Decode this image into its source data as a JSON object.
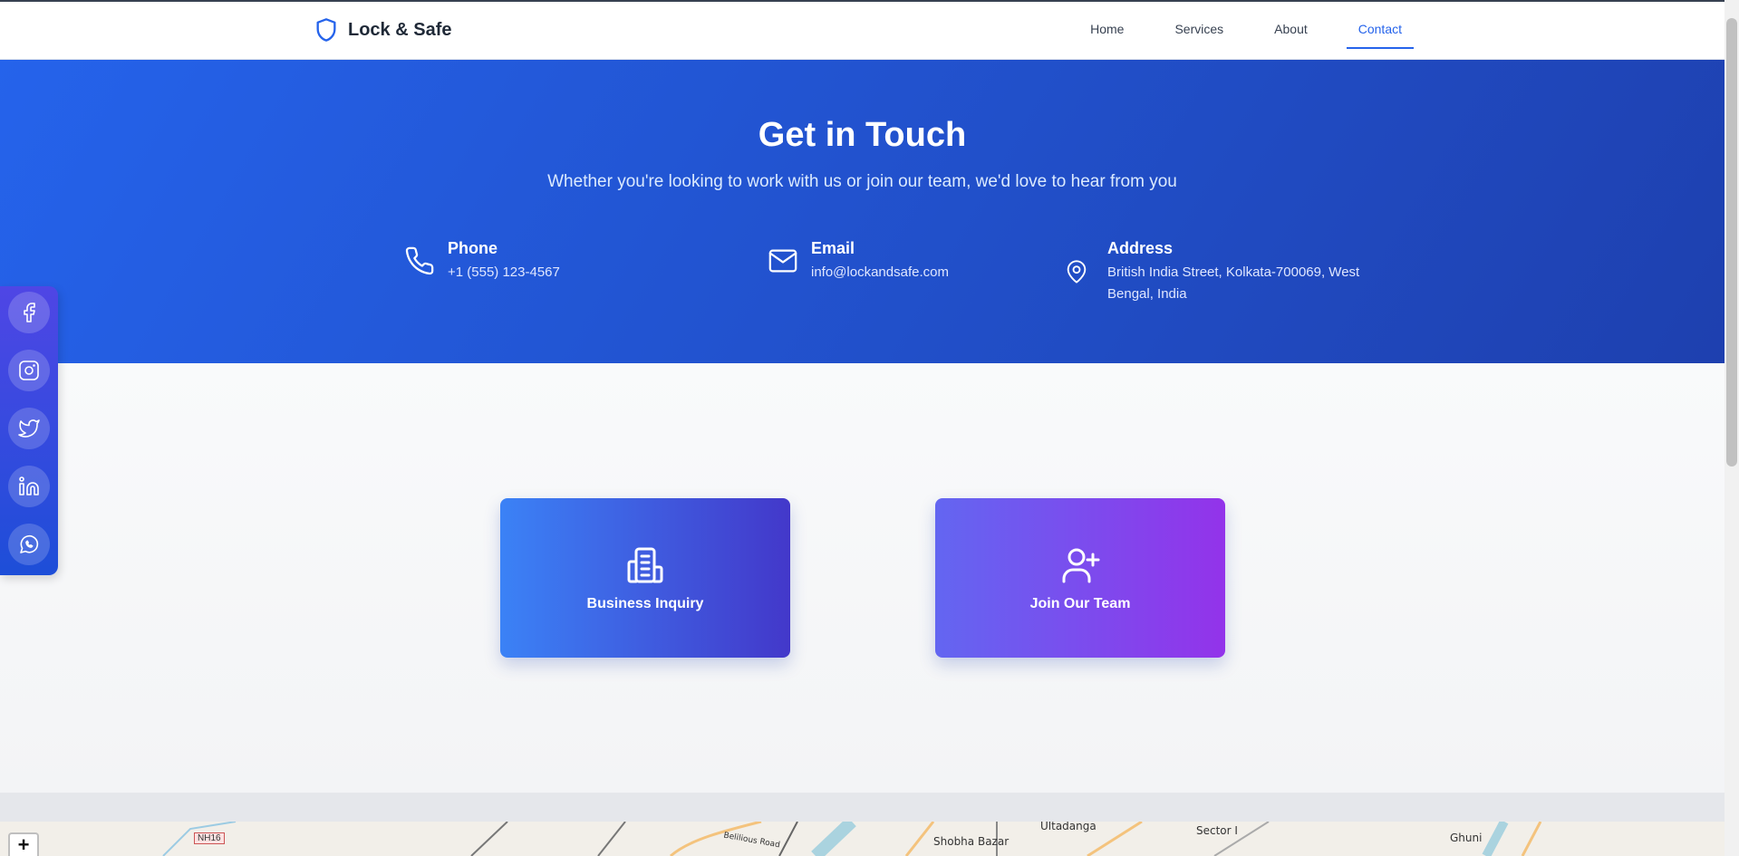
{
  "header": {
    "brand": "Lock & Safe",
    "nav": [
      "Home",
      "Services",
      "About",
      "Contact"
    ],
    "active_nav": "Contact"
  },
  "hero": {
    "title": "Get in Touch",
    "subtitle": "Whether you're looking to work with us or join our team, we'd love to hear from you",
    "phone": {
      "title": "Phone",
      "value": "+1 (555) 123-4567",
      "icon": "phone-icon"
    },
    "email": {
      "title": "Email",
      "value": "info@lockandsafe.com",
      "icon": "mail-icon"
    },
    "address": {
      "title": "Address",
      "value": "British India Street, Kolkata-700069, West Bengal, India",
      "icon": "map-pin-icon"
    }
  },
  "cards": {
    "business": {
      "label": "Business Inquiry",
      "icon": "building-icon"
    },
    "join": {
      "label": "Join Our Team",
      "icon": "user-plus-icon"
    }
  },
  "social": [
    "facebook-icon",
    "instagram-icon",
    "twitter-icon",
    "linkedin-icon",
    "whatsapp-icon"
  ],
  "map": {
    "zoom_in": "+",
    "labels": [
      "NH16",
      "Ultadanga",
      "Sector I",
      "Ghuni",
      "Shobha Bazar",
      "Belilious Road"
    ]
  },
  "colors": {
    "primary": "#2563eb",
    "hero_gradient_end": "#1e40af",
    "card_business_start": "#3b82f6",
    "card_join_end": "#9333ea"
  }
}
